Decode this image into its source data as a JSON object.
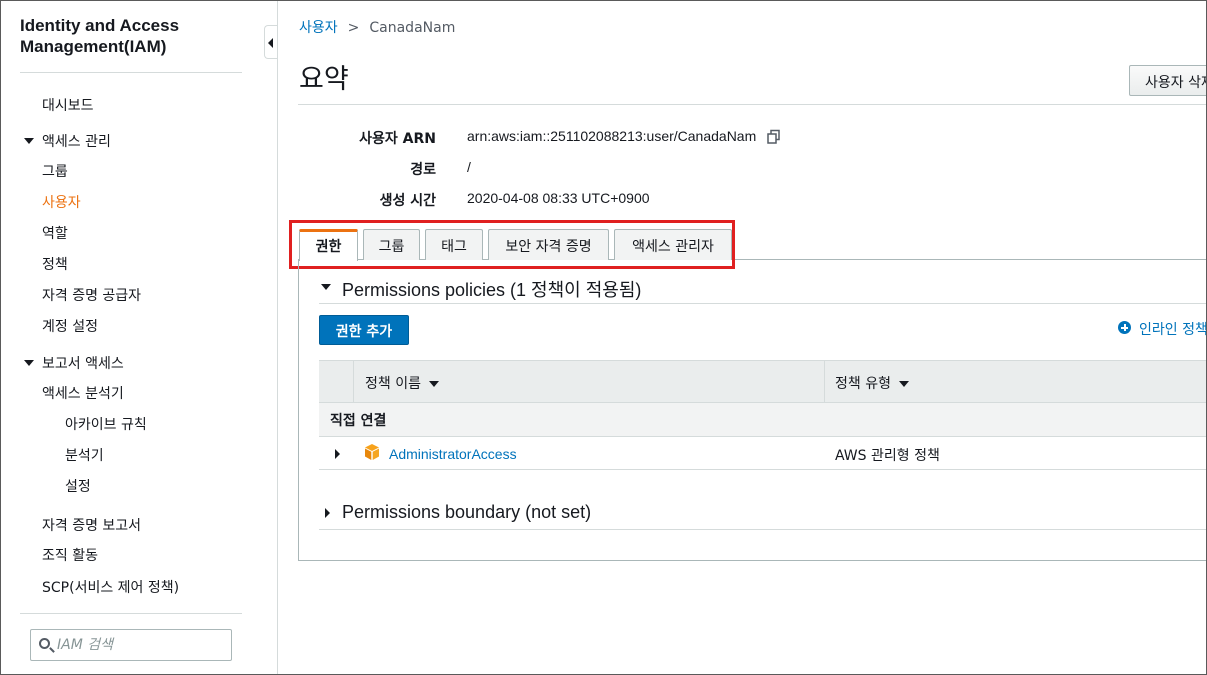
{
  "sidebar": {
    "title": "Identity and Access Management(IAM)",
    "items": [
      {
        "label": "대시보드"
      },
      {
        "label": "액세스 관리"
      },
      {
        "label": "그룹"
      },
      {
        "label": "사용자"
      },
      {
        "label": "역할"
      },
      {
        "label": "정책"
      },
      {
        "label": "자격 증명 공급자"
      },
      {
        "label": "계정 설정"
      },
      {
        "label": "보고서 액세스"
      },
      {
        "label": "액세스 분석기"
      },
      {
        "label": "아카이브 규칙"
      },
      {
        "label": "분석기"
      },
      {
        "label": "설정"
      },
      {
        "label": "자격 증명 보고서"
      },
      {
        "label": "조직 활동"
      },
      {
        "label": "SCP(서비스 제어 정책)"
      }
    ],
    "active_item": "사용자",
    "search_placeholder": "IAM 검색"
  },
  "breadcrumb": {
    "parent": "사용자",
    "separator": ">",
    "current": "CanadaNam"
  },
  "page": {
    "title": "요약",
    "delete_button": "사용자 삭제"
  },
  "summary": {
    "arn_label": "사용자 ARN",
    "arn_value": "arn:aws:iam::251102088213:user/CanadaNam",
    "path_label": "경로",
    "path_value": "/",
    "created_label": "생성 시간",
    "created_value": "2020-04-08 08:33 UTC+0900"
  },
  "tabs": [
    {
      "label": "권한",
      "active": true
    },
    {
      "label": "그룹",
      "active": false
    },
    {
      "label": "태그",
      "active": false
    },
    {
      "label": "보안 자격 증명",
      "active": false
    },
    {
      "label": "액세스 관리자",
      "active": false
    }
  ],
  "permissions": {
    "policies_title": "Permissions policies (1 정책이 적용됨)",
    "add_button": "권한 추가",
    "inline_link": "인라인 정책 추가",
    "columns": [
      "정책 이름",
      "정책 유형"
    ],
    "group_label": "직접 연결",
    "rows": [
      {
        "name": "AdministratorAccess",
        "type": "AWS 관리형 정책"
      }
    ],
    "boundary_title": "Permissions boundary (not set)"
  },
  "colors": {
    "accent": "#ec7211",
    "link": "#0073bb",
    "primary_button": "#0073bb",
    "highlight_box": "#e02020"
  }
}
